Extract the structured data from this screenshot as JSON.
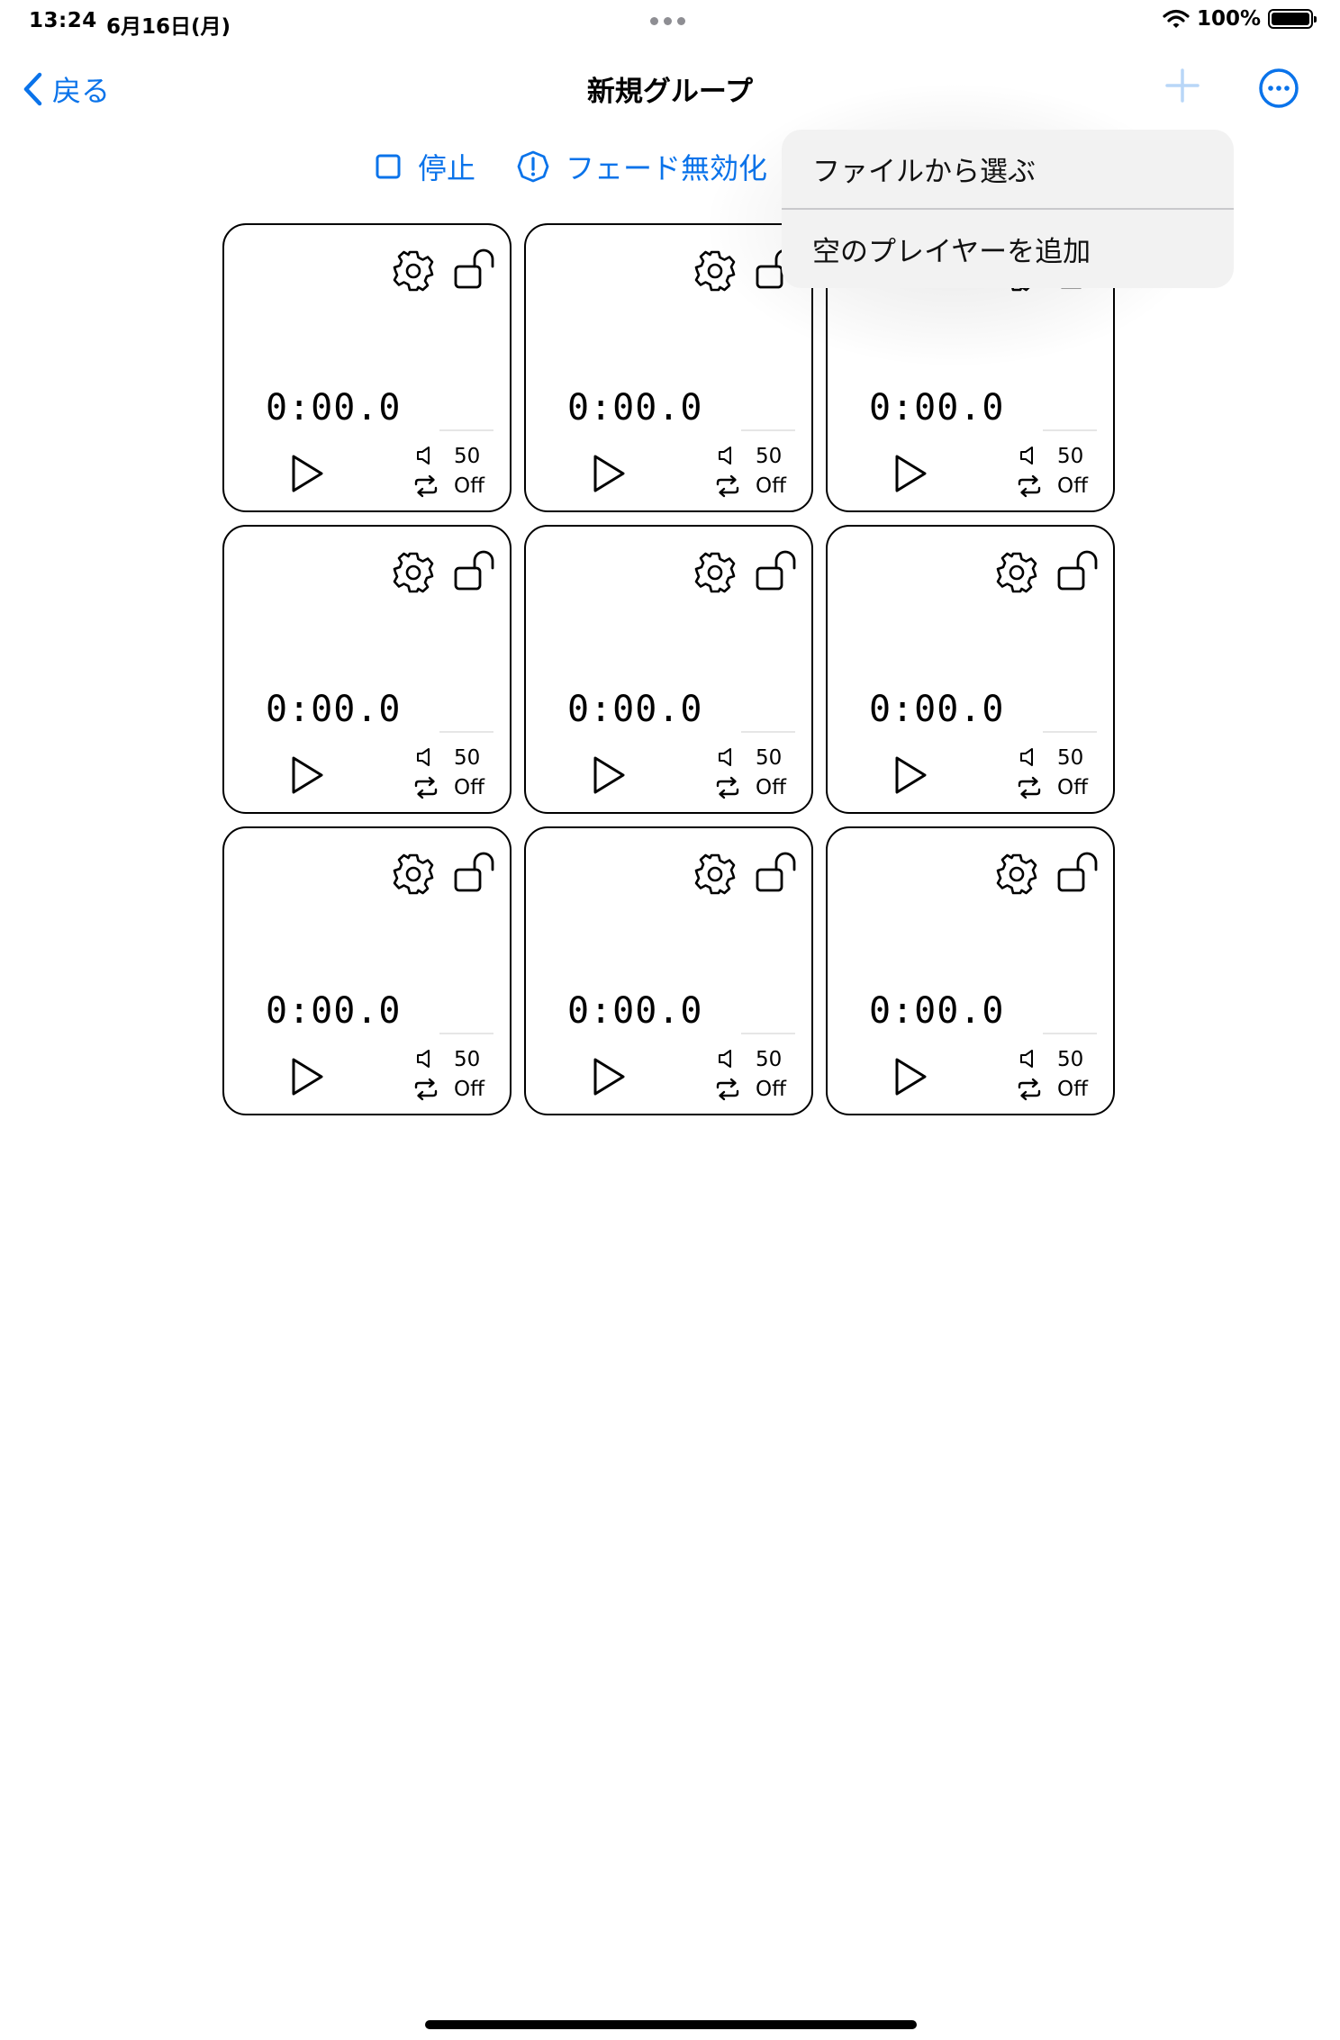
{
  "status_bar": {
    "time": "13:24",
    "date": "6月16日(月)",
    "battery_text": "100%"
  },
  "nav": {
    "back_label": "戻る",
    "title": "新規グループ"
  },
  "toolbar": {
    "stop_label": "停止",
    "fade_label": "フェード無効化"
  },
  "menu": {
    "items": [
      {
        "label": "ファイルから選ぶ"
      },
      {
        "label": "空のプレイヤーを追加"
      }
    ]
  },
  "players": [
    {
      "time": "0:00.0",
      "volume": "50",
      "loop": "Off"
    },
    {
      "time": "0:00.0",
      "volume": "50",
      "loop": "Off"
    },
    {
      "time": "0:00.0",
      "volume": "50",
      "loop": "Off"
    },
    {
      "time": "0:00.0",
      "volume": "50",
      "loop": "Off"
    },
    {
      "time": "0:00.0",
      "volume": "50",
      "loop": "Off"
    },
    {
      "time": "0:00.0",
      "volume": "50",
      "loop": "Off"
    },
    {
      "time": "0:00.0",
      "volume": "50",
      "loop": "Off"
    },
    {
      "time": "0:00.0",
      "volume": "50",
      "loop": "Off"
    },
    {
      "time": "0:00.0",
      "volume": "50",
      "loop": "Off"
    }
  ],
  "colors": {
    "accent": "#0a73ea",
    "accent_disabled": "#b8d6f7",
    "menu_bg": "#f2f2f2"
  },
  "icons": [
    "chevron-left-icon",
    "plus-icon",
    "ellipsis-circle-icon",
    "stop-square-icon",
    "exclamation-circle-icon",
    "gear-icon",
    "unlock-icon",
    "play-icon",
    "speaker-icon",
    "repeat-icon",
    "wifi-icon",
    "battery-icon"
  ]
}
